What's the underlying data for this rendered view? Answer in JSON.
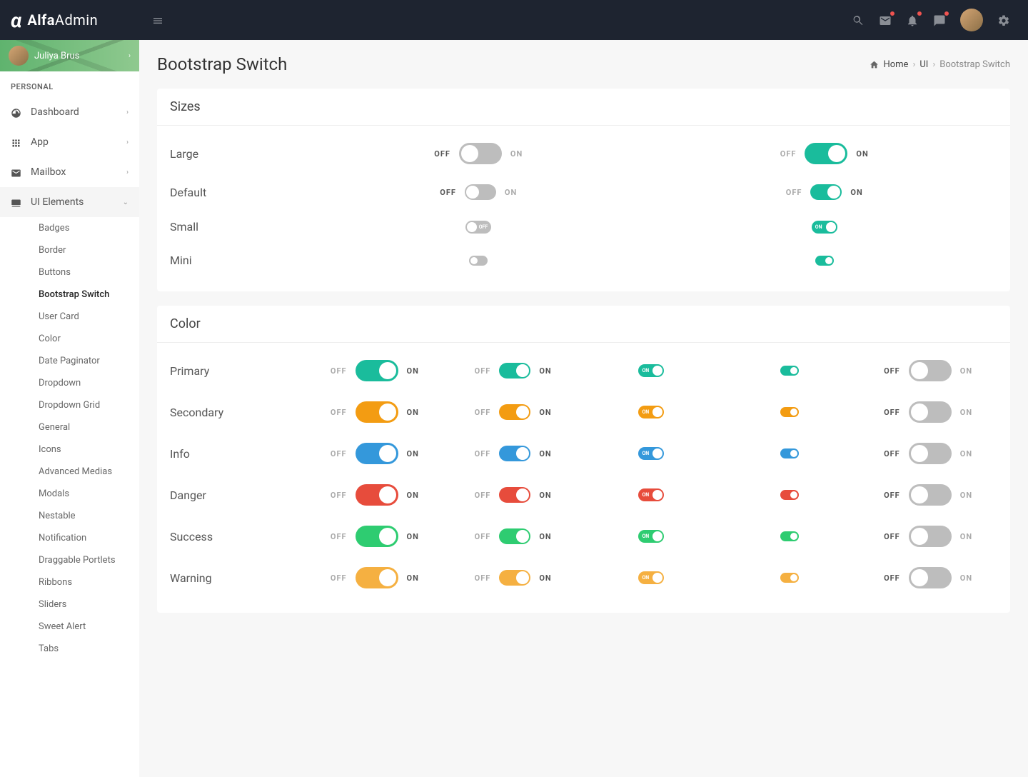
{
  "brand": {
    "bold": "Alfa",
    "light": "Admin"
  },
  "user": {
    "name": "Juliya Brus"
  },
  "sidebar": {
    "section": "PERSONAL",
    "items": [
      {
        "label": "Dashboard"
      },
      {
        "label": "App"
      },
      {
        "label": "Mailbox"
      },
      {
        "label": "UI Elements"
      }
    ],
    "sub": [
      "Badges",
      "Border",
      "Buttons",
      "Bootstrap Switch",
      "User Card",
      "Color",
      "Date Paginator",
      "Dropdown",
      "Dropdown Grid",
      "General",
      "Icons",
      "Advanced Medias",
      "Modals",
      "Nestable",
      "Notification",
      "Draggable Portlets",
      "Ribbons",
      "Sliders",
      "Sweet Alert",
      "Tabs"
    ],
    "active_sub": "Bootstrap Switch"
  },
  "page": {
    "title": "Bootstrap Switch",
    "breadcrumb": {
      "home": "Home",
      "mid": "UI",
      "current": "Bootstrap Switch"
    }
  },
  "labels": {
    "on": "ON",
    "off": "OFF"
  },
  "sizes": {
    "title": "Sizes",
    "rows": [
      {
        "label": "Large"
      },
      {
        "label": "Default"
      },
      {
        "label": "Small"
      },
      {
        "label": "Mini"
      }
    ]
  },
  "colors": {
    "title": "Color",
    "rows": [
      {
        "label": "Primary",
        "class": "c-primary"
      },
      {
        "label": "Secondary",
        "class": "c-secondary"
      },
      {
        "label": "Info",
        "class": "c-info"
      },
      {
        "label": "Danger",
        "class": "c-danger"
      },
      {
        "label": "Success",
        "class": "c-success"
      },
      {
        "label": "Warning",
        "class": "c-warning2"
      }
    ]
  }
}
